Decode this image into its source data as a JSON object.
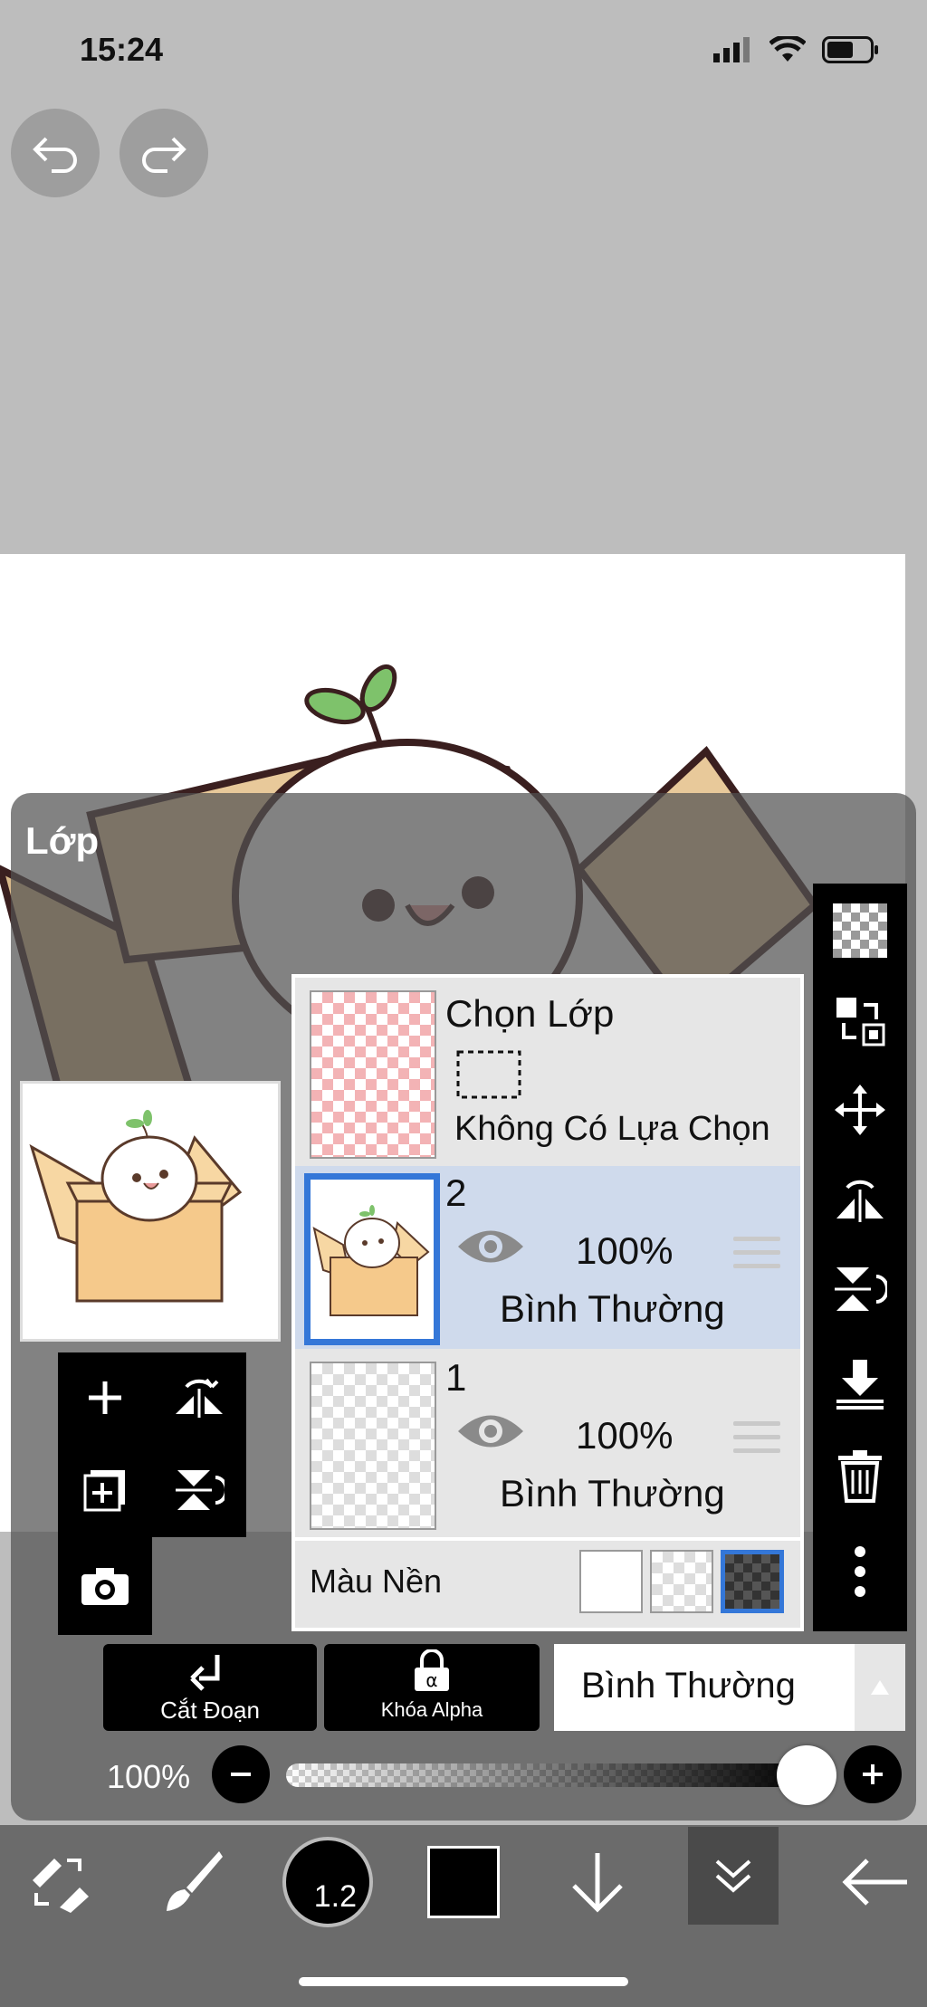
{
  "status": {
    "time": "15:24"
  },
  "panel": {
    "title": "Lớp"
  },
  "selection_layer": {
    "title": "Chọn Lớp",
    "subtitle": "Không Có Lựa Chọn"
  },
  "layers": [
    {
      "number": "2",
      "opacity": "100%",
      "blend": "Bình Thường",
      "selected": true
    },
    {
      "number": "1",
      "opacity": "100%",
      "blend": "Bình Thường",
      "selected": false
    }
  ],
  "background": {
    "label": "Màu Nền",
    "options": [
      "white",
      "transparent",
      "dark"
    ],
    "selected": "dark"
  },
  "actions": {
    "clip_label": "Cắt Đoạn",
    "alpha_lock_label": "Khóa Alpha"
  },
  "blend_mode": {
    "value": "Bình Thường"
  },
  "opacity": {
    "label": "100%",
    "value": 1.0
  },
  "brush": {
    "size": "1.2"
  },
  "colors": {
    "accent": "#3477d8",
    "selected_row": "#cfdaec",
    "primary": "#000000"
  },
  "icons": {
    "top": [
      "undo-icon",
      "redo-icon"
    ],
    "left_tools": [
      "add-layer-icon",
      "flip-horizontal-icon",
      "add-layer-copy-icon",
      "flip-vertical-icon",
      "camera-icon"
    ],
    "right_strip": [
      "transparency-icon",
      "selection-swap-icon",
      "move-icon",
      "flip-rotate-horizontal-icon",
      "flip-rotate-vertical-icon",
      "merge-down-icon",
      "trash-icon",
      "more-icon"
    ],
    "bottom": [
      "tool-switch-icon",
      "brush-icon",
      "brush-size-icon",
      "color-icon",
      "down-arrow-icon",
      "collapse-icon",
      "back-arrow-icon"
    ]
  }
}
